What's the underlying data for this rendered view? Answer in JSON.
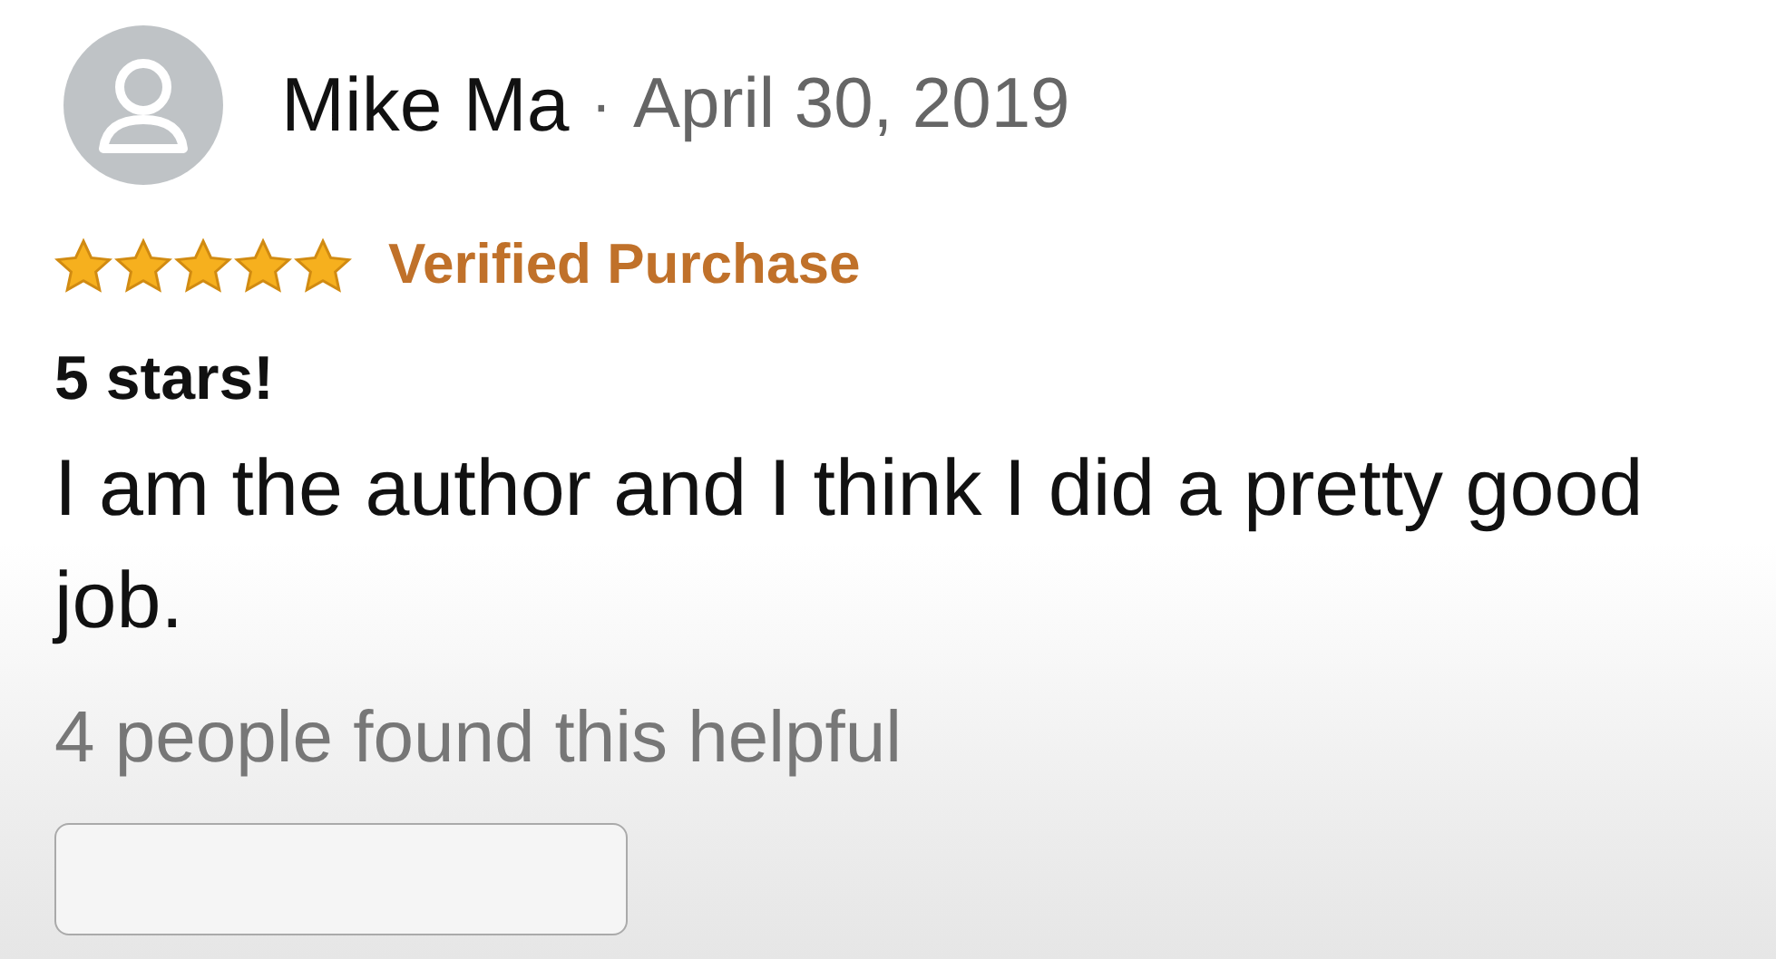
{
  "review": {
    "author": "Mike Ma",
    "separator": "·",
    "date": "April 30, 2019",
    "stars": 5,
    "badge": "Verified Purchase",
    "title": "5 stars!",
    "body": "I am the author and I think I did a pretty good job.",
    "helpful": "4 people found this helpful"
  }
}
